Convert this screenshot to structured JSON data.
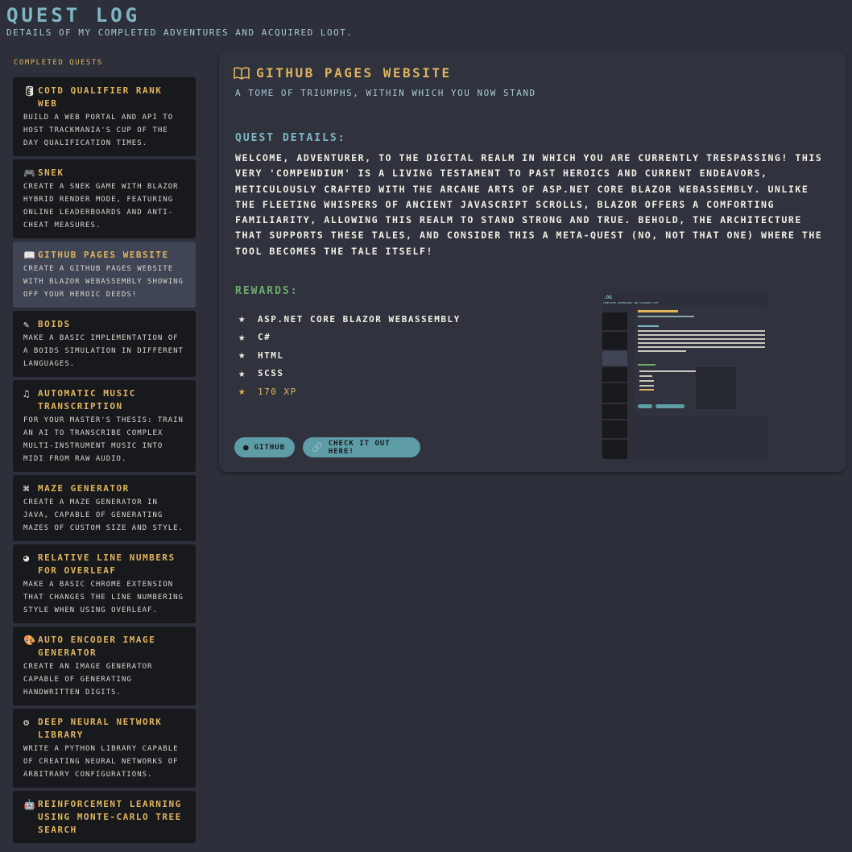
{
  "header": {
    "title": "Quest Log",
    "subtitle": "Details of my completed adventures and acquired loot."
  },
  "sidebar": {
    "heading": "Completed Quests",
    "quests": [
      {
        "icon": "database-icon",
        "glyph": "🛢",
        "title": "COTD Qualifier Rank Web",
        "desc": "Build a web portal and API to host Trackmania's Cup of the Day qualification times."
      },
      {
        "icon": "gamepad-icon",
        "glyph": "🎮",
        "title": "Snek",
        "desc": "Create a Snek game with Blazor Hybrid render mode, featuring online leaderboards and anti-cheat measures."
      },
      {
        "icon": "book-icon",
        "glyph": "📖",
        "title": "GitHub Pages Website",
        "desc": "Create a GitHub Pages website with Blazor WebAssembly showing off your heroic deeds!"
      },
      {
        "icon": "feather-icon",
        "glyph": "✎",
        "title": "Boids",
        "desc": "Make a basic implementation of a boids simulation in different languages."
      },
      {
        "icon": "music-icon",
        "glyph": "♫",
        "title": "Automatic Music Transcription",
        "desc": "For your master's thesis: train an AI to transcribe complex multi-instrument music into MIDI from raw audio."
      },
      {
        "icon": "command-icon",
        "glyph": "⌘",
        "title": "Maze Generator",
        "desc": "Create a maze generator in Java, capable of generating mazes of custom size and style."
      },
      {
        "icon": "chrome-icon",
        "glyph": "◕",
        "title": "Relative Line Numbers for Overleaf",
        "desc": "Make a basic Chrome extension that changes the line numbering style when using Overleaf."
      },
      {
        "icon": "palette-icon",
        "glyph": "🎨",
        "title": "Auto Encoder Image Generator",
        "desc": "Create an image generator capable of generating handwritten digits."
      },
      {
        "icon": "cpu-icon",
        "glyph": "⚙",
        "title": "Deep Neural Network Library",
        "desc": "Write a Python library capable of creating neural networks of arbitrary configurations."
      },
      {
        "icon": "robot-icon",
        "glyph": "🤖",
        "title": "Reinforcement Learning using Monte-Carlo Tree Search",
        "desc": ""
      }
    ]
  },
  "detail": {
    "title": "GitHub Pages Website",
    "subtitle": "A tome of triumphs, within which you now stand",
    "details_heading": "Quest Details:",
    "details_text": "Welcome, adventurer, to the digital realm in which you are currently trespassing! This very 'Compendium' is a living testament to past heroics and current endeavors, meticulously crafted with the arcane arts of ASP.NET Core Blazor WebAssembly. Unlike the fleeting whispers of ancient JavaScript scrolls, Blazor offers a comforting familiarity, allowing this realm to stand strong and true. Behold, the architecture that supports these tales, and consider this a meta-quest (no, not that one) where the tool becomes the tale itself!",
    "rewards_heading": "Rewards:",
    "rewards": [
      "ASP.NET Core Blazor WebAssembly",
      "C#",
      "HTML",
      "SCSS"
    ],
    "xp": "170 XP",
    "github_label": "GitHub",
    "live_label": "Check it out here!"
  },
  "colors": {
    "background": "#2d303a",
    "card": "#18191d",
    "active_card": "#404555",
    "gold": "#e0b45e",
    "teal": "#7fb6c4",
    "green": "#6fa86f",
    "button": "#5e9ca6"
  }
}
